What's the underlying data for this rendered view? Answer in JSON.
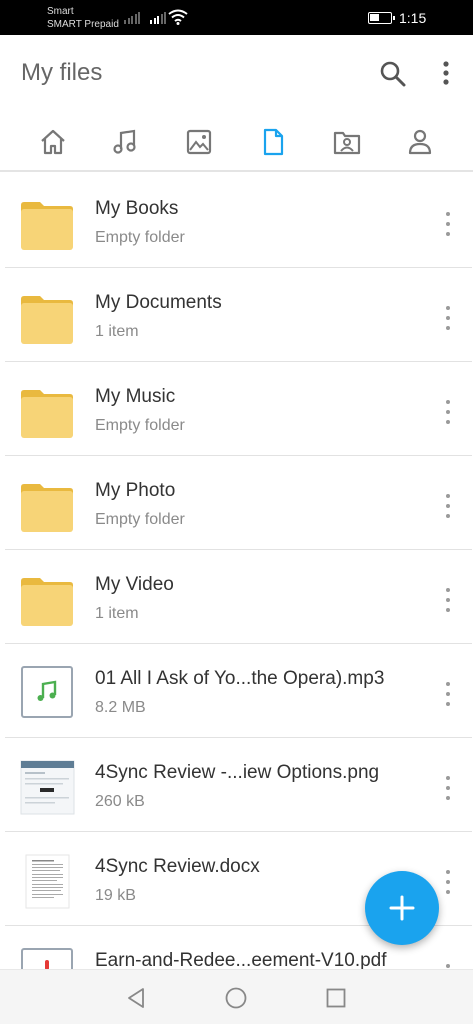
{
  "status_bar": {
    "carrier_line1": "Smart",
    "carrier_line2": "SMART Prepaid",
    "time": "1:15"
  },
  "app_bar": {
    "title": "My files",
    "search_icon": "search-icon",
    "more_icon": "more-vert-icon"
  },
  "tabs": [
    {
      "icon": "home-icon",
      "selected": false
    },
    {
      "icon": "music-icon",
      "selected": false
    },
    {
      "icon": "image-icon",
      "selected": false
    },
    {
      "icon": "document-icon",
      "selected": true
    },
    {
      "icon": "video-folder-icon",
      "selected": false
    },
    {
      "icon": "person-icon",
      "selected": false
    }
  ],
  "items": [
    {
      "name": "My Books",
      "meta": "Empty folder",
      "kind": "folder"
    },
    {
      "name": "My Documents",
      "meta": "1 item",
      "kind": "folder"
    },
    {
      "name": "My Music",
      "meta": "Empty folder",
      "kind": "folder"
    },
    {
      "name": "My Photo",
      "meta": "Empty folder",
      "kind": "folder"
    },
    {
      "name": "My Video",
      "meta": "1 item",
      "kind": "folder"
    },
    {
      "name": "01 All I Ask of Yo...the Opera).mp3",
      "meta": "8.2 MB",
      "kind": "audio"
    },
    {
      "name": "4Sync Review -...iew Options.png",
      "meta": "260 kB",
      "kind": "image"
    },
    {
      "name": "4Sync Review.docx",
      "meta": "19 kB",
      "kind": "doc"
    },
    {
      "name": "Earn-and-Redee...eement-V10.pdf",
      "meta": "",
      "kind": "pdf"
    }
  ],
  "colors": {
    "accent": "#1aa3ee",
    "folder": "#f7d477",
    "folder_tab": "#e9b93f"
  }
}
